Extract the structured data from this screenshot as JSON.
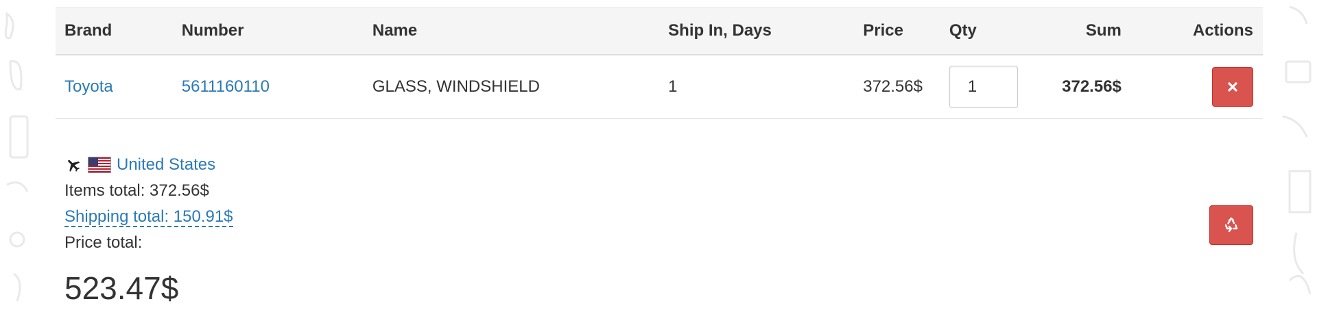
{
  "table": {
    "headers": {
      "brand": "Brand",
      "number": "Number",
      "name": "Name",
      "ship_in": "Ship In, Days",
      "price": "Price",
      "qty": "Qty",
      "sum": "Sum",
      "actions": "Actions"
    },
    "rows": [
      {
        "brand": "Toyota",
        "number": "5611160110",
        "name": "GLASS, WINDSHIELD",
        "ship_in": "1",
        "price": "372.56$",
        "qty": "1",
        "sum": "372.56$",
        "remove_icon": "close-icon"
      }
    ]
  },
  "summary": {
    "transport_icon": "airplane-icon",
    "flag_icon": "us-flag-icon",
    "origin_country": "United States",
    "items_total": "Items total: 372.56$",
    "shipping_total": "Shipping total: 150.91$",
    "price_total_label": "Price total:",
    "price_total_value": "523.47$"
  },
  "actions": {
    "clear_cart_icon": "recycle-icon"
  },
  "colors": {
    "link": "#2a7ab7",
    "danger": "#d9534f",
    "header_bg": "#f5f5f5",
    "border": "#dddddd"
  }
}
